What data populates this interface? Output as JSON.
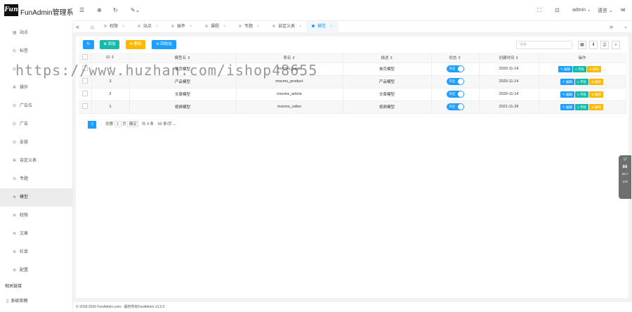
{
  "app": {
    "logo_mark": "Fun",
    "title": "FunAdmin管理系"
  },
  "topbar": {
    "user": "admin",
    "language": "语言"
  },
  "sidebar": {
    "items": [
      {
        "label": "站点",
        "icon": "doc-icon"
      },
      {
        "label": "标签",
        "icon": "circle-icon"
      },
      {
        "label": "",
        "icon": "circle-icon"
      },
      {
        "label": "操作",
        "icon": "gear-icon"
      },
      {
        "label": "广告位",
        "icon": "circle-icon"
      },
      {
        "label": "广告",
        "icon": "circle-icon"
      },
      {
        "label": "友链",
        "icon": "circle-icon"
      },
      {
        "label": "自定义表",
        "icon": "gear-icon"
      },
      {
        "label": "专题",
        "icon": "circle-icon"
      },
      {
        "label": "模型",
        "icon": "stack-icon"
      },
      {
        "label": "权限",
        "icon": "stack-icon"
      },
      {
        "label": "文章",
        "icon": "stack-icon"
      },
      {
        "label": "栏目",
        "icon": "stack-icon"
      },
      {
        "label": "配置",
        "icon": "stack-icon"
      }
    ],
    "group_label": "相关链接",
    "link_label": "系统官网"
  },
  "tabs": [
    {
      "label": "权限"
    },
    {
      "label": "站点"
    },
    {
      "label": "插件"
    },
    {
      "label": "课程"
    },
    {
      "label": "专题"
    },
    {
      "label": "自定义表"
    },
    {
      "label": "模型"
    }
  ],
  "toolbar": {
    "add": "添加",
    "delete": "删除",
    "recycle": "回收站",
    "search_placeholder": "搜索"
  },
  "table": {
    "columns": [
      "ID",
      "模型名",
      "表名",
      "描述",
      "状态",
      "创建时间",
      "操作"
    ],
    "rows": [
      {
        "id": "4",
        "name": "单页模型",
        "table": "mocms_page",
        "desc": "单页模型",
        "status": "开启",
        "created": "2020-11-14"
      },
      {
        "id": "3",
        "name": "产品模型",
        "table": "mocms_product",
        "desc": "产品模型",
        "status": "开启",
        "created": "2020-11-14"
      },
      {
        "id": "2",
        "name": "文章模型",
        "table": "mocms_article",
        "desc": "文章模型",
        "status": "开启",
        "created": "2020-11-14"
      },
      {
        "id": "1",
        "name": "视频模型",
        "table": "mocms_video",
        "desc": "视频模型",
        "status": "开启",
        "created": "2021-11-29"
      }
    ],
    "ops": {
      "edit": "编辑",
      "field": "字段",
      "delete": "删除"
    }
  },
  "pager": {
    "current": "1",
    "goto": "到第",
    "page_input": "1",
    "page_unit": "页",
    "confirm": "确定",
    "total": "共 4 条",
    "per_page": "50 条/页"
  },
  "footer": "© 2018-2030 FunAdmin.com - 版权所有FunAdmin v3.3.0",
  "watermark": "https://www.huzhan.com/ishop48655",
  "widget": {
    "value": "66",
    "up": "26.7",
    "down": "176"
  }
}
